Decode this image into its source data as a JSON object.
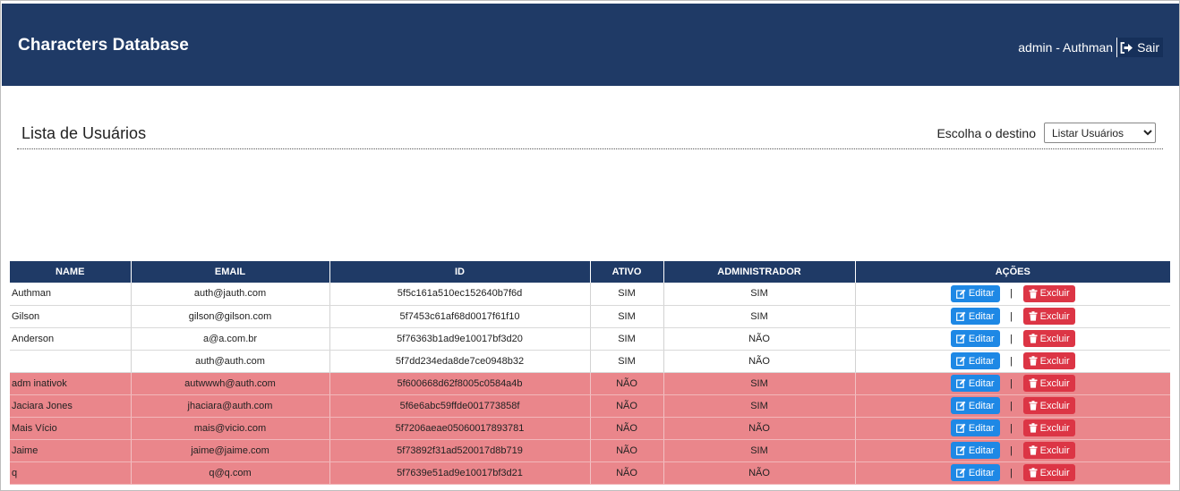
{
  "app": {
    "title": "Characters Database",
    "user_label": "admin - Authman",
    "logout_label": "Sair"
  },
  "page": {
    "title": "Lista de Usuários",
    "destination_label": "Escolha o destino",
    "destination_value": "Listar Usuários"
  },
  "colors": {
    "header": "#1f3a66",
    "inactive_row": "#ea868b",
    "edit_button": "#1e88e5",
    "delete_button": "#dc3545"
  },
  "table": {
    "headers": [
      "NAME",
      "EMAIL",
      "ID",
      "ATIVO",
      "ADMINISTRADOR",
      "AÇÕES"
    ],
    "edit_label": "Editar",
    "delete_label": "Excluir",
    "separator": "|",
    "rows": [
      {
        "name": "Authman",
        "email": "auth@jauth.com",
        "id": "5f5c161a510ec152640b7f6d",
        "ativo": "SIM",
        "admin": "SIM",
        "inactive": false
      },
      {
        "name": "Gilson",
        "email": "gilson@gilson.com",
        "id": "5f7453c61af68d0017f61f10",
        "ativo": "SIM",
        "admin": "SIM",
        "inactive": false
      },
      {
        "name": "Anderson",
        "email": "a@a.com.br",
        "id": "5f76363b1ad9e10017bf3d20",
        "ativo": "SIM",
        "admin": "NÃO",
        "inactive": false
      },
      {
        "name": "",
        "email": "auth@auth.com",
        "id": "5f7dd234eda8de7ce0948b32",
        "ativo": "SIM",
        "admin": "NÃO",
        "inactive": false
      },
      {
        "name": "adm inativok",
        "email": "autwwwh@auth.com",
        "id": "5f600668d62f8005c0584a4b",
        "ativo": "NÃO",
        "admin": "SIM",
        "inactive": true
      },
      {
        "name": "Jaciara Jones",
        "email": "jhaciara@auth.com",
        "id": "5f6e6abc59ffde001773858f",
        "ativo": "NÃO",
        "admin": "SIM",
        "inactive": true
      },
      {
        "name": "Mais Vício",
        "email": "mais@vicio.com",
        "id": "5f7206aeae05060017893781",
        "ativo": "NÃO",
        "admin": "NÃO",
        "inactive": true
      },
      {
        "name": "Jaime",
        "email": "jaime@jaime.com",
        "id": "5f73892f31ad520017d8b719",
        "ativo": "NÃO",
        "admin": "SIM",
        "inactive": true
      },
      {
        "name": "q",
        "email": "q@q.com",
        "id": "5f7639e51ad9e10017bf3d21",
        "ativo": "NÃO",
        "admin": "NÃO",
        "inactive": true
      }
    ]
  }
}
